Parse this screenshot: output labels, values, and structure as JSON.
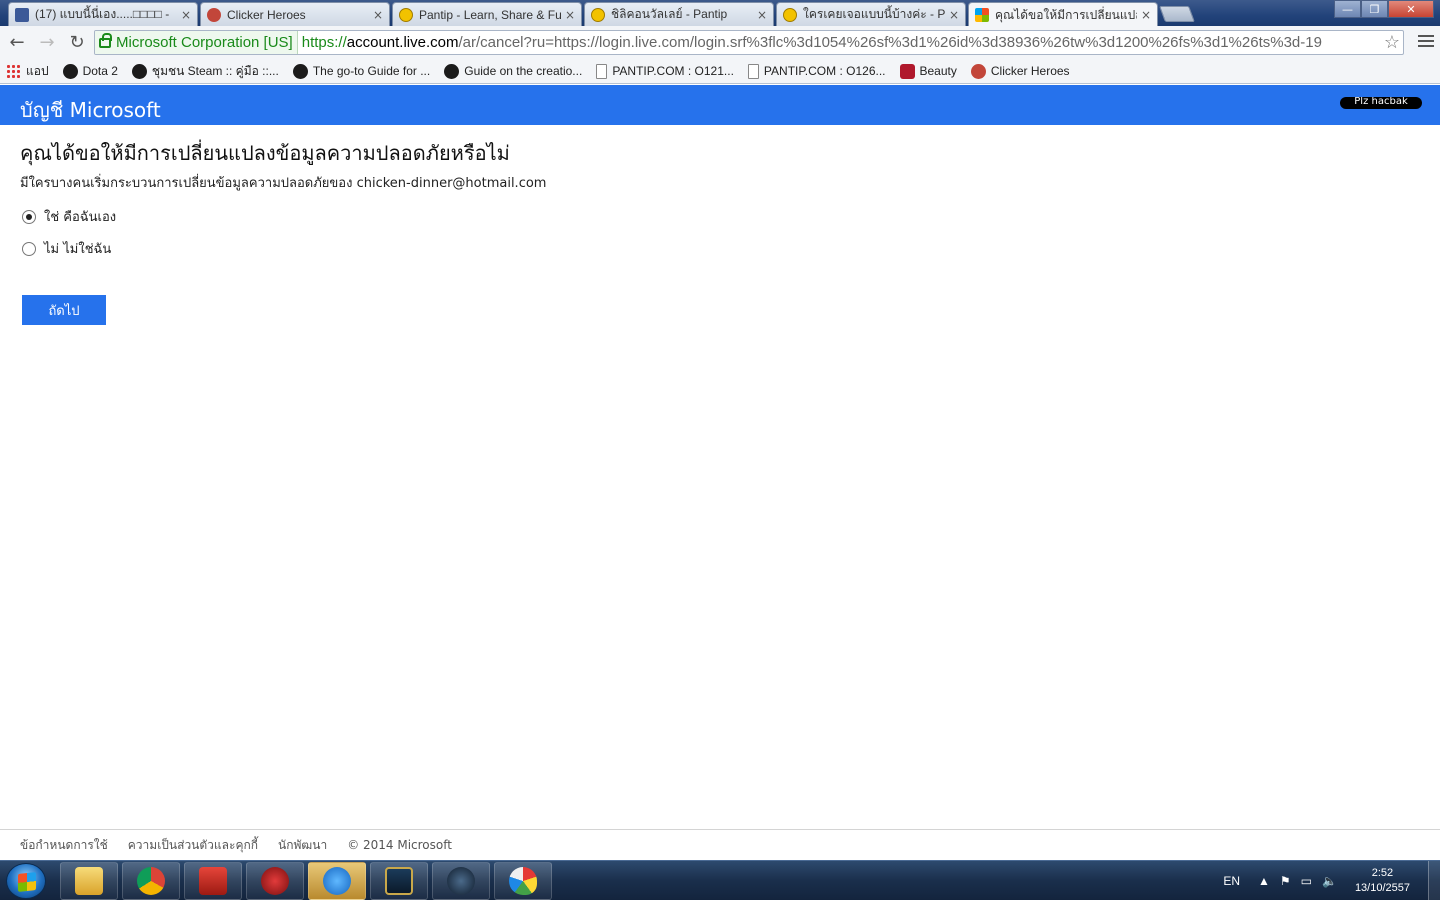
{
  "browser": {
    "tabs": [
      {
        "title": "(17) แบบนี้นี่เอง.....□□□□ - ",
        "favicon": "facebook-icon",
        "active": false
      },
      {
        "title": "Clicker Heroes",
        "favicon": "clicker-heroes-icon",
        "active": false
      },
      {
        "title": "Pantip - Learn, Share & Fu",
        "favicon": "pantip-icon",
        "active": false
      },
      {
        "title": "ชิลิคอนวัลเลย์ - Pantip",
        "favicon": "pantip-icon",
        "active": false
      },
      {
        "title": "ใครเคยเจอแบบนี้บ้างค่ะ - Pa",
        "favicon": "pantip-icon",
        "active": false
      },
      {
        "title": "คุณได้ขอให้มีการเปลี่ยนแปล",
        "favicon": "microsoft-icon",
        "active": true
      }
    ],
    "close_glyph": "×",
    "window_controls": {
      "minimize": "—",
      "maximize": "❐",
      "close": "✕"
    },
    "nav": {
      "back": "←",
      "forward": "→",
      "reload": "↻"
    },
    "omnibox": {
      "ev_label": "Microsoft Corporation [US]",
      "scheme": "https://",
      "host": "account.live.com",
      "path": "/ar/cancel?ru=https://login.live.com/login.srf%3flc%3d1054%26sf%3d1%26id%3d38936%26tw%3d1200%26fs%3d1%26ts%3d-19",
      "star_glyph": "☆"
    },
    "bookmarks": [
      {
        "label": "แอป",
        "icon": "apps-icon"
      },
      {
        "label": "Dota 2",
        "icon": "steam-icon"
      },
      {
        "label": "ชุมชน Steam :: คู่มือ ::...",
        "icon": "steam-icon"
      },
      {
        "label": "The go-to Guide for ...",
        "icon": "steam-icon"
      },
      {
        "label": "Guide on the creatio...",
        "icon": "steam-icon"
      },
      {
        "label": "PANTIP.COM : O121...",
        "icon": "page-icon"
      },
      {
        "label": "PANTIP.COM : O126...",
        "icon": "page-icon"
      },
      {
        "label": "Beauty",
        "icon": "beauty-icon"
      },
      {
        "label": "Clicker Heroes",
        "icon": "clicker-heroes-icon"
      }
    ]
  },
  "page": {
    "brand": "บัญชี Microsoft",
    "user_name": "Plz hacbak",
    "heading": "คุณได้ขอให้มีการเปลี่ยนแปลงข้อมูลความปลอดภัยหรือไม่",
    "description": "มีใครบางคนเริ่มกระบวนการเปลี่ยนข้อมูลความปลอดภัยของ chicken-dinner@hotmail.com",
    "options": [
      {
        "label": "ใช่ คือฉันเอง",
        "checked": true
      },
      {
        "label": "ไม่ ไม่ใช่ฉัน",
        "checked": false
      }
    ],
    "next_label": "ถัดไป",
    "accent_color": "#2672ec"
  },
  "footer": {
    "links": [
      "ข้อกำหนดการใช้",
      "ความเป็นส่วนตัวและคุกกี้",
      "นักพัฒนา"
    ],
    "copyright": "© 2014 Microsoft"
  },
  "taskbar": {
    "apps": [
      "windows-explorer-icon",
      "chrome-icon",
      "flash-icon",
      "game-app-icon",
      "chat-app-icon",
      "league-of-legends-icon",
      "steam-icon",
      "paint-icon"
    ],
    "tray": {
      "language": "EN",
      "time": "2:52",
      "date": "13/10/2557"
    }
  }
}
